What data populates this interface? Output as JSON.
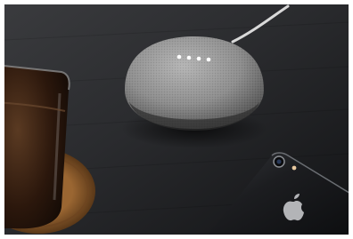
{
  "scene": {
    "description_tags": [
      "smart-speaker",
      "smartphone",
      "glass-on-coaster",
      "dark-table"
    ],
    "colors": {
      "table": "#1e1f21",
      "speaker_fabric": "#8e8e8e",
      "led": "#ffffff",
      "phone_body": "#1b1c1f",
      "coaster": "#8a5a2b",
      "drink": "#2b170c"
    },
    "speaker": {
      "led_count": 4
    }
  }
}
